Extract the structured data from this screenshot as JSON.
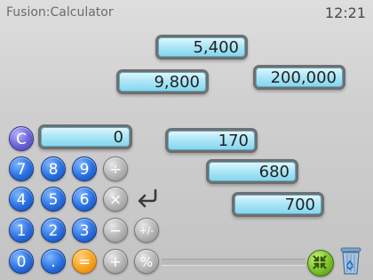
{
  "header": {
    "app_title": "Fusion:Calculator",
    "time": "12:21"
  },
  "display": {
    "value": "0"
  },
  "canvas_numbers": [
    {
      "value": "5,400"
    },
    {
      "value": "9,800"
    },
    {
      "value": "200,000"
    },
    {
      "value": "170"
    },
    {
      "value": "680"
    },
    {
      "value": "700"
    }
  ],
  "keypad": {
    "clear": "C",
    "digits": [
      "0",
      "1",
      "2",
      "3",
      "4",
      "5",
      "6",
      "7",
      "8",
      "9"
    ],
    "decimal": ".",
    "divide": "÷",
    "multiply": "×",
    "subtract": "−",
    "add": "+",
    "equals": "=",
    "plus_minus": "+/-",
    "percent": "%"
  },
  "icons": {
    "backspace": "undo-arrow-icon",
    "shrink": "collapse-arrows-icon",
    "trash": "recycle-bin-icon"
  },
  "colors": {
    "number_key": "#2a6fe0",
    "operator_key": "#b3b3b3",
    "clear_key": "#6a62d6",
    "equals_key": "#f6a21d",
    "chip": "#aee7f7"
  }
}
